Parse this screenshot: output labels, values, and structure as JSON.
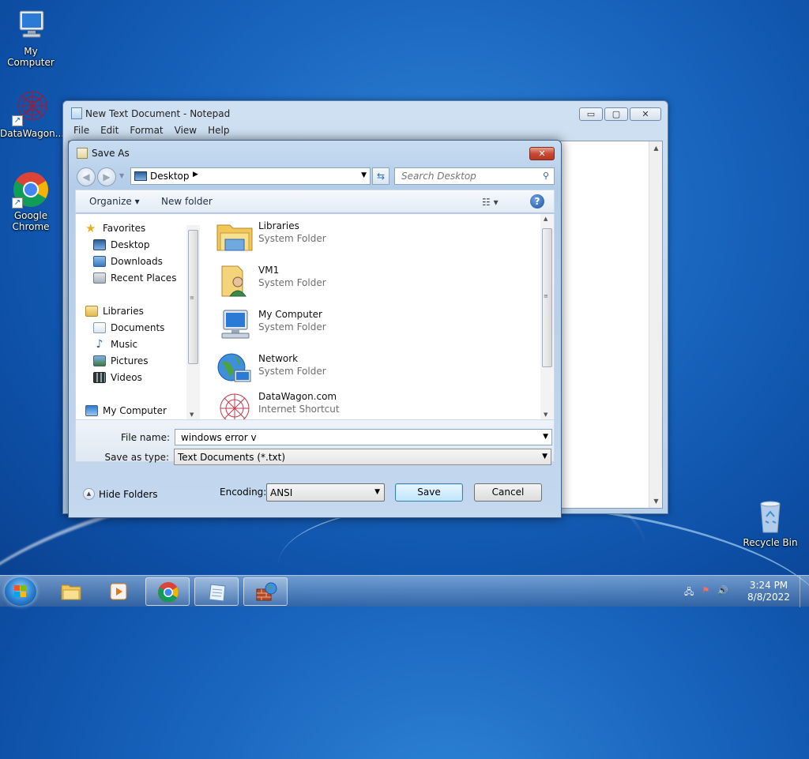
{
  "desktop": {
    "icons": [
      {
        "label": "My Computer"
      },
      {
        "label": "DataWagon..."
      },
      {
        "label": "Google Chrome"
      },
      {
        "label": "Recycle Bin"
      }
    ]
  },
  "notepad": {
    "title": "New Text Document - Notepad",
    "menu": [
      "File",
      "Edit",
      "Format",
      "View",
      "Help"
    ],
    "buttons": {
      "minimize": "▭",
      "maximize": "▢",
      "close": "✕"
    }
  },
  "dialog": {
    "title": "Save As",
    "close": "✕",
    "address": {
      "location": "Desktop",
      "chevron": "▶"
    },
    "search": {
      "placeholder": "Search Desktop"
    },
    "toolbar": {
      "organize": "Organize ▾",
      "new_folder": "New folder",
      "help": "?"
    },
    "nav_pane": [
      {
        "label": "Favorites",
        "group": true
      },
      {
        "label": "Desktop"
      },
      {
        "label": "Downloads"
      },
      {
        "label": "Recent Places"
      },
      {
        "label": "Libraries",
        "group": true
      },
      {
        "label": "Documents"
      },
      {
        "label": "Music"
      },
      {
        "label": "Pictures"
      },
      {
        "label": "Videos"
      },
      {
        "label": "My Computer",
        "group": true
      }
    ],
    "files": [
      {
        "name": "Libraries",
        "type": "System Folder"
      },
      {
        "name": "VM1",
        "type": "System Folder"
      },
      {
        "name": "My Computer",
        "type": "System Folder"
      },
      {
        "name": "Network",
        "type": "System Folder"
      },
      {
        "name": "DataWagon.com",
        "type": "Internet Shortcut"
      }
    ],
    "file_name": {
      "label": "File name:",
      "value": "windows error v"
    },
    "save_as_type": {
      "label": "Save as type:",
      "value": "Text Documents (*.txt)"
    },
    "hide_folders": "Hide Folders",
    "encoding": {
      "label": "Encoding:",
      "value": "ANSI"
    },
    "save_button": "Save",
    "cancel_button": "Cancel"
  },
  "taskbar": {
    "clock": {
      "time": "3:24 PM",
      "date": "8/8/2022"
    }
  }
}
